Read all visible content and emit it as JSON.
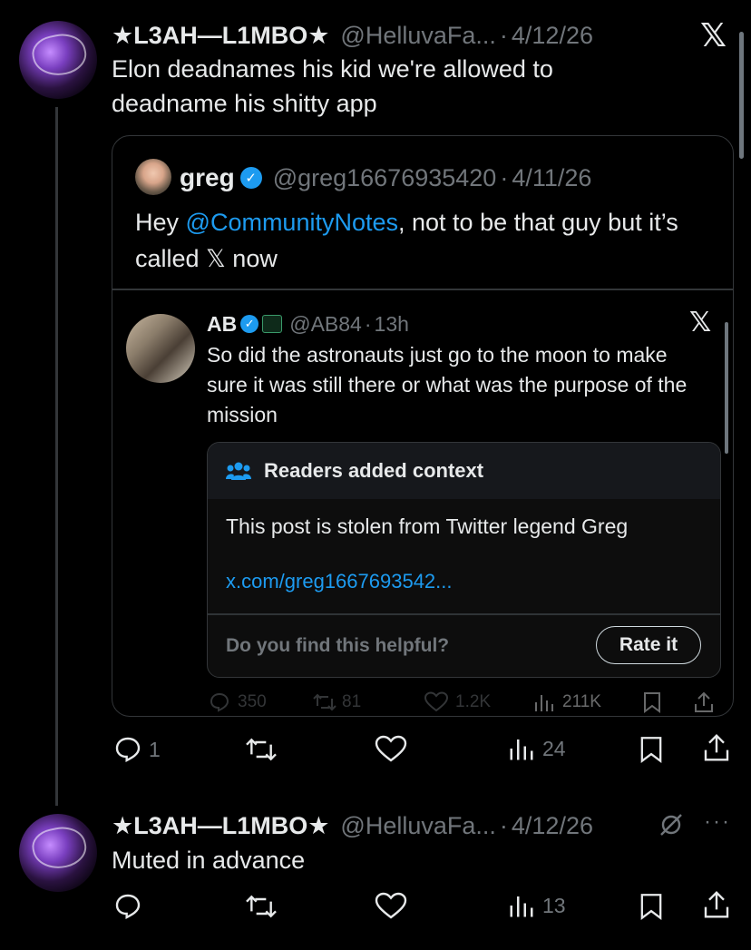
{
  "reply1": {
    "display_name": "★L3AH—L1MBO★",
    "handle": "@HelluvaFa...",
    "date": "4/12/26",
    "text": "Elon deadnames his kid we're allowed to deadname his shitty app",
    "actions": {
      "reply_count": "1",
      "views": "24"
    }
  },
  "quote": {
    "display_name": "greg",
    "handle": "@greg16676935420",
    "date": "4/11/26",
    "text_prefix": "Hey ",
    "mention": "@CommunityNotes",
    "text_suffix": ", not to be that guy but it’s called 𝕏 now"
  },
  "embedded": {
    "display_name": "AB",
    "handle": "@AB84",
    "date": "13h",
    "text": "So did the astronauts just go to the moon to make sure it was still there or what was the purpose of the mission",
    "note": {
      "header": "Readers added context",
      "body": "This post is stolen from Twitter legend Greg",
      "link": "x.com/greg1667693542...",
      "question": "Do you find this helpful?",
      "rate_label": "Rate it"
    },
    "stats": {
      "replies": "350",
      "reposts": "81",
      "likes": "1.2K",
      "views": "211K"
    }
  },
  "reply2": {
    "display_name": "★L3AH—L1MBO★",
    "handle": "@HelluvaFa...",
    "date": "4/12/26",
    "text": "Muted in advance",
    "actions": {
      "views": "13"
    }
  },
  "dot_sep": "·",
  "logo": "𝕏",
  "colors": {
    "link": "#1d9bf0",
    "muted": "#71767b",
    "background": "#000000",
    "border": "#333639"
  },
  "icons": [
    "x-logo-icon",
    "verified-badge-icon",
    "readers-icon",
    "reply-icon",
    "repost-icon",
    "like-icon",
    "views-icon",
    "bookmark-icon",
    "share-icon",
    "mute-icon",
    "more-icon"
  ]
}
